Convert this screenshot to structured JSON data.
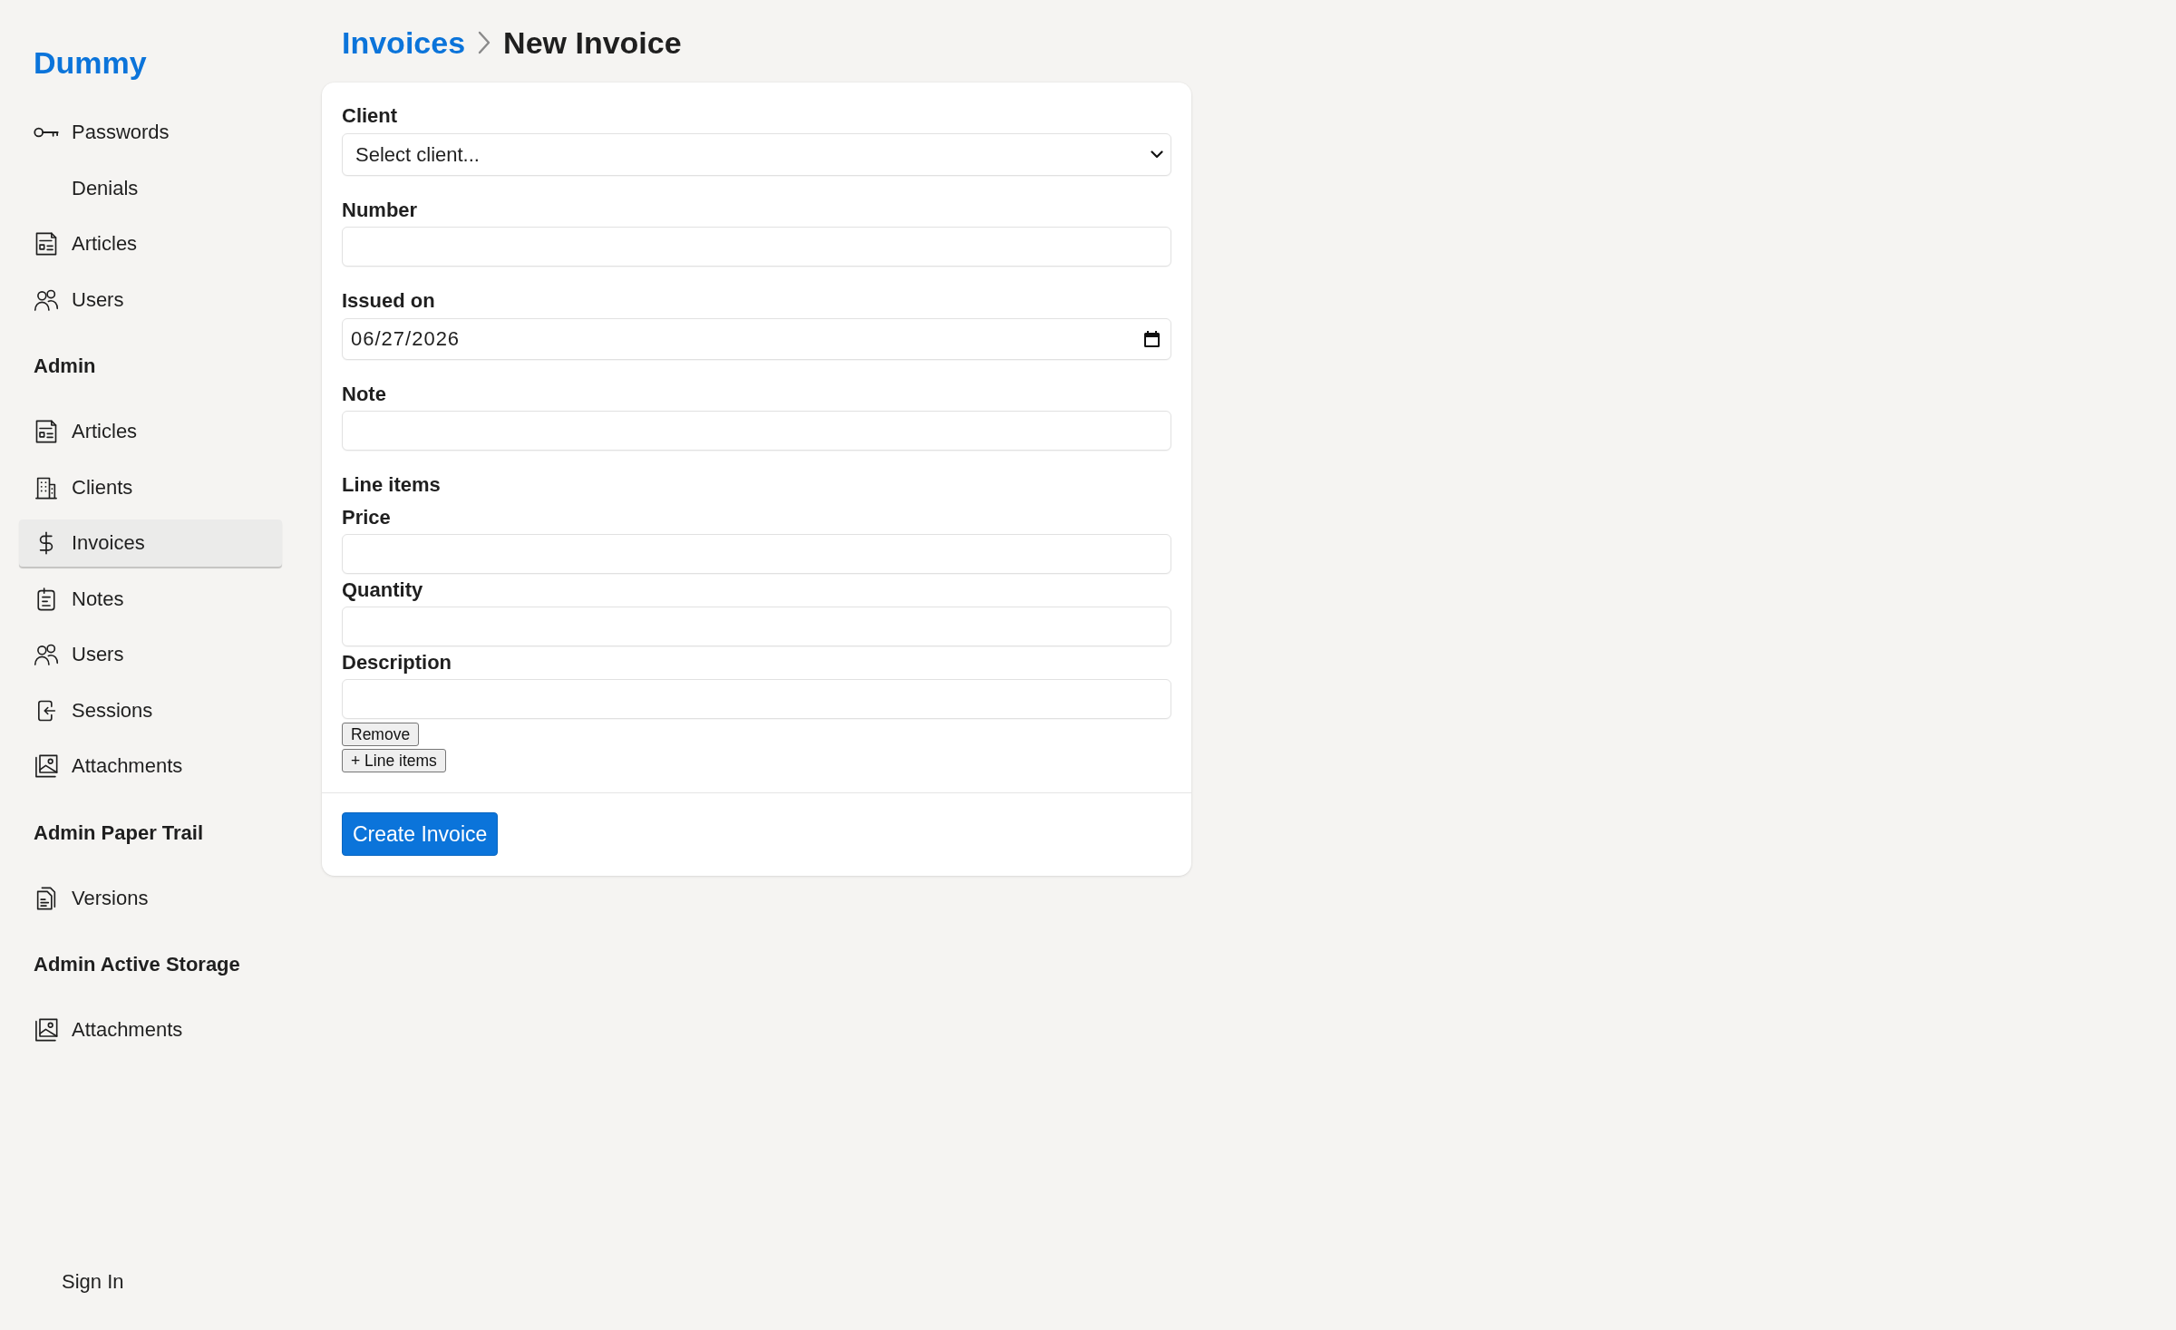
{
  "sidebar": {
    "brand": "Dummy",
    "sections": [
      {
        "items": [
          {
            "label": "Passwords",
            "selected": false
          },
          {
            "label": "Denials",
            "selected": false
          },
          {
            "label": "Articles",
            "selected": false
          },
          {
            "label": "Users",
            "selected": false
          }
        ]
      },
      {
        "heading": "Admin",
        "items": [
          {
            "label": "Articles",
            "selected": false
          },
          {
            "label": "Clients",
            "selected": false
          },
          {
            "label": "Invoices",
            "selected": true
          },
          {
            "label": "Notes",
            "selected": false
          },
          {
            "label": "Users",
            "selected": false
          },
          {
            "label": "Sessions",
            "selected": false
          },
          {
            "label": "Attachments",
            "selected": false
          }
        ]
      },
      {
        "heading": "Admin Paper Trail",
        "items": [
          {
            "label": "Versions",
            "selected": false
          }
        ]
      },
      {
        "heading": "Admin Active Storage",
        "items": [
          {
            "label": "Attachments",
            "selected": false
          }
        ]
      }
    ],
    "sign_in": "Sign In"
  },
  "breadcrumb": [
    {
      "label": "Invoices",
      "kind": "link"
    },
    {
      "label": "New Invoice",
      "kind": "current"
    }
  ],
  "form": {
    "fields": [
      {
        "label": "Client",
        "kind": "select",
        "value": "Select client..."
      },
      {
        "label": "Number",
        "kind": "text"
      },
      {
        "label": "Issued on",
        "kind": "date",
        "value": "06/27/2026"
      },
      {
        "label": "Note",
        "kind": "text"
      }
    ],
    "line_items": {
      "title": "Line items",
      "fields": [
        {
          "label": "Price",
          "kind": "text"
        },
        {
          "label": "Quantity",
          "kind": "text"
        },
        {
          "label": "Description",
          "kind": "text"
        }
      ],
      "remove_button": "Remove"
    },
    "add_button": "+ Line items",
    "submit_button": "Create Invoice"
  }
}
